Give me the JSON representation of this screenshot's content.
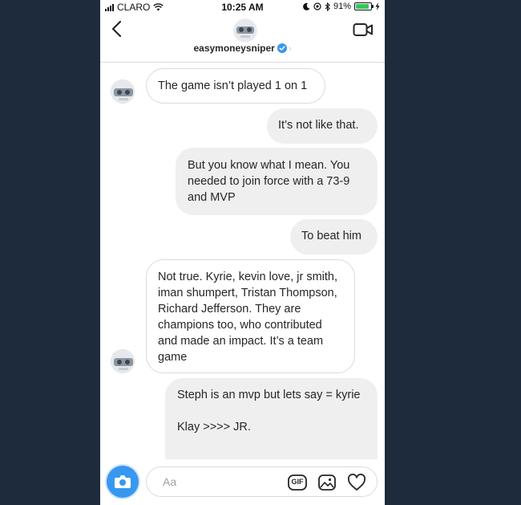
{
  "status_bar": {
    "carrier": "CLARO",
    "time": "10:25 AM",
    "battery": "91%",
    "battery_level": 0.91,
    "battery_color": "#35c759"
  },
  "header": {
    "username": "easymoneysniper",
    "verified_icon": "verified-badge-icon",
    "back_icon": "back-arrow-icon",
    "video_icon": "video-camera-icon"
  },
  "messages": [
    {
      "direction": "received",
      "text": "The game isn’t played 1 on 1"
    },
    {
      "direction": "sent",
      "text": "It’s not like that."
    },
    {
      "direction": "sent",
      "text": "But you know what I mean. You needed to join force with a 73-9 and MVP"
    },
    {
      "direction": "sent",
      "text": "To beat him"
    },
    {
      "direction": "received",
      "text": "Not true. Kyrie, kevin love, jr smith, iman shumpert, Tristan Thompson, Richard Jefferson. They are champions too, who contributed and made an impact. It’s a team game"
    },
    {
      "direction": "sent",
      "text": "Steph is an mvp but lets say = kyrie\n\nKlay >>>> JR."
    }
  ],
  "composer": {
    "placeholder": "Aa",
    "value": "",
    "camera_icon": "camera-icon",
    "gif_label": "GIF",
    "gallery_icon": "image-gallery-icon",
    "like_icon": "heart-icon",
    "accent_color": "#3897f0"
  }
}
